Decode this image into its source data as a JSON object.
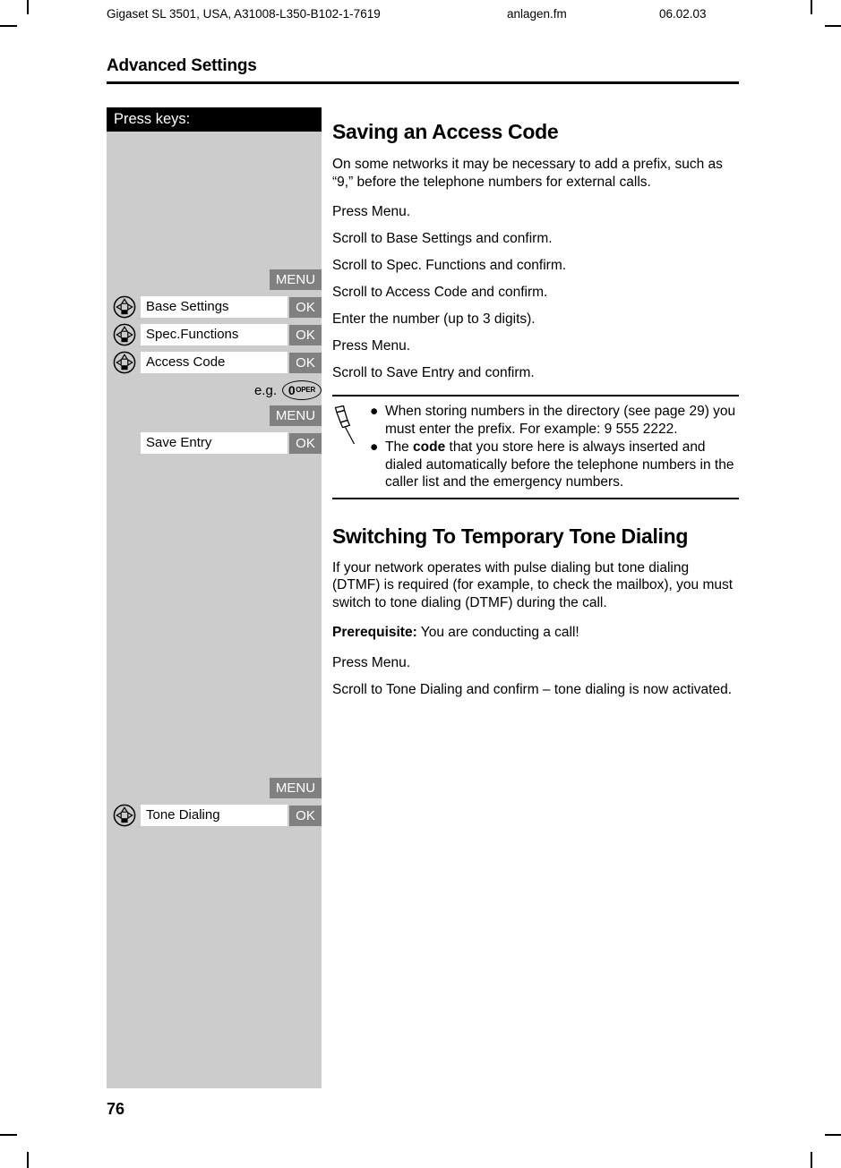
{
  "running_head": {
    "document": "Gigaset SL 3501, USA, A31008-L350-B102-1-7619",
    "file": "anlagen.fm",
    "date": "06.02.03"
  },
  "chapter": {
    "title": "Advanced Settings"
  },
  "keys_panel": {
    "header": "Press keys:",
    "rows": [
      {
        "softkey": "MENU"
      },
      {
        "icon": "navigation-key-icon",
        "display": "Base Settings",
        "softkey": "OK"
      },
      {
        "icon": "navigation-key-icon",
        "display": "Spec.Functions",
        "softkey": "OK"
      },
      {
        "icon": "navigation-key-icon",
        "display": "Access Code",
        "softkey": "OK"
      },
      {
        "prefix": "e.g.",
        "digit_key": {
          "number": "0",
          "sub": "OPER"
        }
      },
      {
        "softkey": "MENU"
      },
      {
        "display": "Save Entry",
        "softkey": "OK"
      },
      {
        "softkey": "MENU"
      },
      {
        "icon": "navigation-key-icon",
        "display": "Tone Dialing",
        "softkey": "OK"
      }
    ]
  },
  "sections": [
    {
      "heading": "Saving an Access Code",
      "intro": "On some networks it may be necessary to add a prefix, such as “9,” before the telephone numbers for external calls.",
      "steps": [
        "Press Menu.",
        "Scroll to Base Settings and confirm.",
        "Scroll to Spec. Functions and confirm.",
        "Scroll to Access Code and confirm.",
        "Enter the number (up to 3 digits).",
        "Press Menu.",
        "Scroll to Save Entry and confirm."
      ]
    },
    {
      "heading": "Switching To Temporary Tone Dialing",
      "intro": "If your network operates with pulse dialing but tone dialing (DTMF) is required (for example, to check the mailbox), you must switch to tone dialing (DTMF) during the call.",
      "prerequisite_label": "Prerequisite:",
      "prerequisite_text": " You are conducting a call!",
      "steps": [
        "Press Menu.",
        "Scroll to Tone Dialing and confirm – tone dialing is now activated."
      ]
    }
  ],
  "note_box": {
    "icon": "pushpin-icon",
    "bullet": "●",
    "items": [
      {
        "text": "When storing numbers in the directory (see page 29) you must enter the prefix. For example: 9 555 2222."
      },
      {
        "pre": "The ",
        "bold": "code",
        "post": " that you store here is always inserted and dialed automatically before the telephone numbers in the caller list and the emergency numbers."
      }
    ]
  },
  "footer": {
    "page_number": "76"
  },
  "colors": {
    "softkey_gray": "#808080",
    "panel_gray": "#cccccc",
    "header_black": "#000000"
  }
}
